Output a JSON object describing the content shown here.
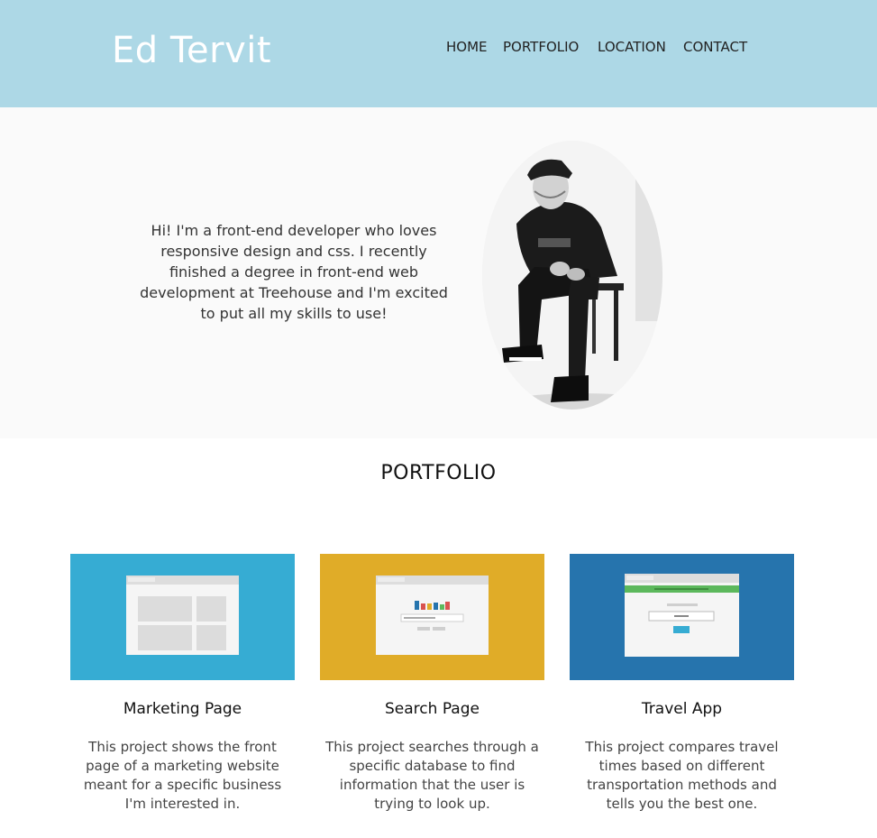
{
  "header": {
    "title": "Ed Tervit",
    "nav": [
      "HOME",
      "PORTFOLIO",
      "LOCATION",
      "CONTACT"
    ]
  },
  "hero": {
    "intro": "Hi! I'm a front-end developer who loves responsive design and css. I recently finished a degree in front-end web development at Treehouse and I'm excited to put all my skills to use!"
  },
  "portfolio": {
    "title": "PORTFOLIO",
    "projects": [
      {
        "title": "Marketing Page",
        "description": "This project shows the front page of a marketing website meant for a specific business I'm interested in.",
        "color": "#36acd3"
      },
      {
        "title": "Search Page",
        "description": "This project searches through a specific database to find information that the user is trying to look up.",
        "color": "#e0ac28"
      },
      {
        "title": "Travel App",
        "description": "This project compares travel times based on different transportation methods and tells you the best one.",
        "color": "#2674ad"
      }
    ]
  },
  "colors": {
    "header_bg": "#add8e6",
    "hero_bg": "#fafafa"
  }
}
